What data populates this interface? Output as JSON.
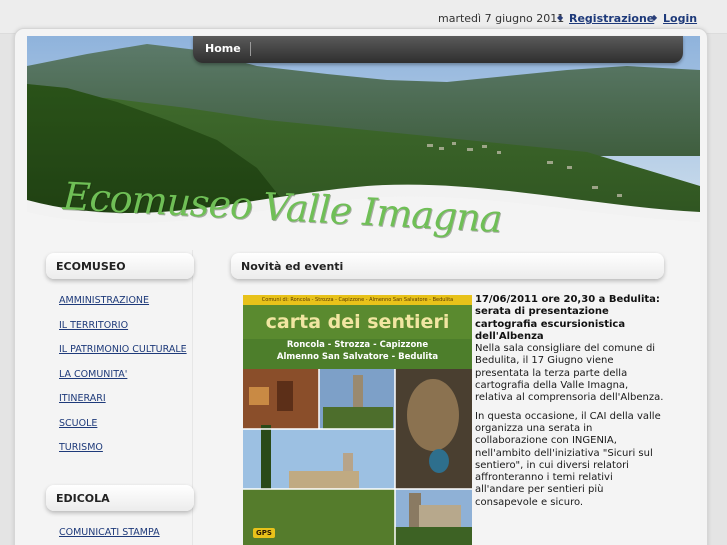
{
  "topbar": {
    "date": "martedì 7 giugno 2011",
    "separator": "◆",
    "register_label": "Registrazione",
    "login_label": "Login"
  },
  "header": {
    "site_title": "Ecomuseo Valle Imagna"
  },
  "nav": {
    "items": [
      {
        "label": "Home"
      }
    ]
  },
  "sidebar": {
    "ecomuseo": {
      "title": "ECOMUSEO",
      "items": [
        {
          "label": "AMMINISTRAZIONE"
        },
        {
          "label": "IL TERRITORIO"
        },
        {
          "label": "IL PATRIMONIO CULTURALE"
        },
        {
          "label": "LA COMUNITA'"
        },
        {
          "label": "ITINERARI"
        },
        {
          "label": "SCUOLE"
        },
        {
          "label": "TURISMO"
        }
      ]
    },
    "edicola": {
      "title": "EDICOLA",
      "items": [
        {
          "label": "COMUNICATI STAMPA"
        }
      ]
    }
  },
  "main": {
    "section_title": "Novità ed eventi",
    "news": {
      "headline": "17/06/2011 ore 20,30 a Bedulita: serata di presentazione cartografia escursionistica dell'Albenza",
      "paragraph1": "Nella sala consigliare del comune di Bedulita, il 17 Giugno viene presentata la terza parte della cartografia della Valle Imagna, relativa al comprensoria dell'Albenza.",
      "paragraph2": "In questa occasione, il CAI della valle organizza una serata in collaborazione con INGENIA, nell'ambito dell'iniziativa \"Sicuri sul sentiero\", in cui diversi relatori affronteranno i temi relativi all'andare per sentieri più consapevole e sicuro."
    },
    "poster": {
      "strip_text": "Comuni di: Roncola - Strozza - Capizzone - Almenno San Salvatore - Bedulita",
      "title": "carta dei sentieri",
      "subtitle_line1": "Roncola - Strozza - Capizzone",
      "subtitle_line2": "Almenno San Salvatore - Bedulita",
      "badge": "GPS"
    }
  },
  "colors": {
    "link": "#1e3a7a",
    "title_green": "#6fbf56",
    "poster_green": "#4f7f2a",
    "poster_yellow": "#f0d220"
  }
}
